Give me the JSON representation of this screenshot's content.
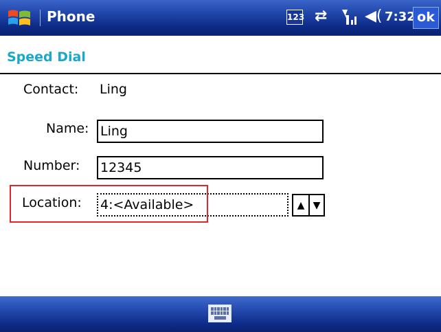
{
  "titlebar": {
    "app_title": "Phone",
    "status_icons": [
      "windows-start-icon",
      "input-123-icon",
      "sync-icon",
      "signal-icon",
      "volume-icon"
    ],
    "input_indicator": "123",
    "clock": "7:32",
    "ok_label": "ok"
  },
  "page": {
    "title": "Speed Dial"
  },
  "form": {
    "contact_label": "Contact:",
    "contact_value": "Ling",
    "name_label": "Name:",
    "name_value": "Ling",
    "number_label": "Number:",
    "number_value": "12345",
    "location_label": "Location:",
    "location_value": "4:<Available>"
  },
  "bottombar": {
    "keyboard_icon": "keyboard-icon"
  },
  "colors": {
    "titlebar_blue": "#1f44a8",
    "page_title": "#1ba7c9",
    "highlight_red": "#e0262c"
  }
}
